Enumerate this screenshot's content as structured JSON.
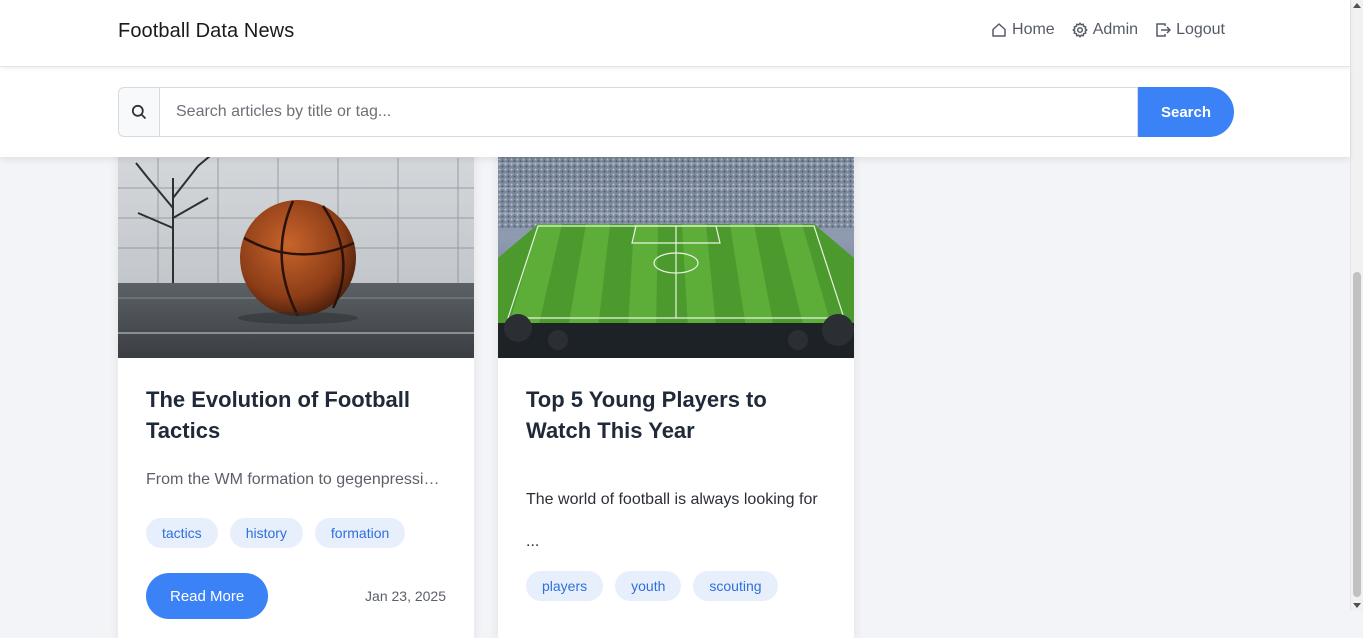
{
  "navbar": {
    "brand": "Football Data News",
    "links": [
      {
        "label": "Home",
        "icon": "home-icon"
      },
      {
        "label": "Admin",
        "icon": "gear-icon"
      },
      {
        "label": "Logout",
        "icon": "logout-icon"
      }
    ]
  },
  "search": {
    "placeholder": "Search articles by title or tag...",
    "value": "",
    "button_label": "Search"
  },
  "articles": [
    {
      "title": "The Evolution of Football Tactics",
      "excerpt": "From the WM formation to gegenpressing...",
      "tags": [
        "tactics",
        "history",
        "formation"
      ],
      "read_more": "Read More",
      "date": "Jan 23, 2025",
      "image": "basketball-photo"
    },
    {
      "title": "Top 5 Young Players to Watch This Year",
      "excerpt_line1": "The world of football is always looking for",
      "excerpt_line2": "...",
      "tags": [
        "players",
        "youth",
        "scouting"
      ],
      "image": "stadium-photo"
    }
  ],
  "colors": {
    "accent": "#3b82f6",
    "tag_bg": "#e8effc",
    "tag_text": "#2f6fdc",
    "page_bg": "#f3f4f7"
  }
}
